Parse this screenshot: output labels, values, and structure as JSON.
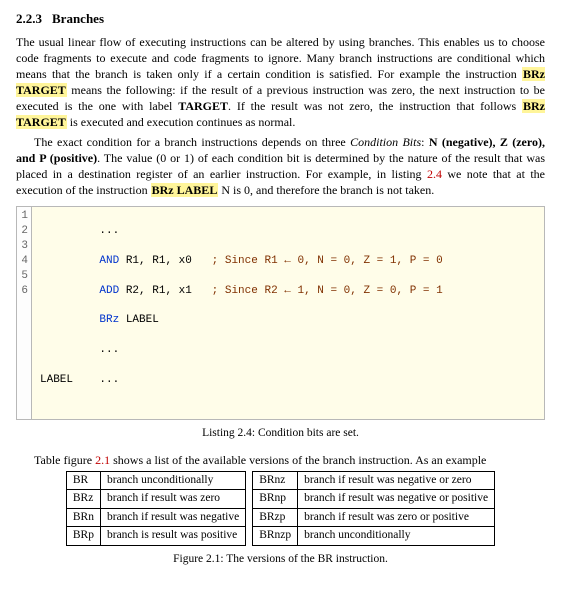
{
  "heading": {
    "number": "2.2.3",
    "title": "Branches"
  },
  "para1_a": "The usual linear flow of executing instructions can be altered by using branches. This enables us to choose code fragments to execute and code fragments to ignore. Many branch instructions are conditional which means that the branch is taken only if a certain condition is satisfied. For example the instruction ",
  "para1_hl1": "BRz TARGET",
  "para1_b": " means the following: if the result of a previous instruction was zero, the next instruction to be executed is the one with label ",
  "para1_bold1": "TARGET",
  "para1_c": ". If the result was not zero, the instruction that follows ",
  "para1_hl2": "BRz TARGET",
  "para1_d": " is executed and execution continues as normal.",
  "para2_a": "The exact condition for a branch instructions depends on three ",
  "para2_em": "Condition Bits",
  "para2_b": ": ",
  "para2_bold": "N (negative), Z (zero), and P (positive)",
  "para2_c": ". The value (0 or 1) of each condition bit is determined by the nature of the result that was placed in a destination register of an earlier instruction. For example, in listing ",
  "para2_ref": "2.4",
  "para2_d": " we note that at the execution of the instruction ",
  "para2_hl": "BRz LABEL",
  "para2_e": " N is 0, and therefore the branch is not taken.",
  "listing": {
    "gutter": [
      "1",
      "2",
      "3",
      "4",
      "5",
      "6"
    ],
    "lines": {
      "l1": "         ...",
      "l2a": "         ",
      "l2kw": "AND",
      "l2b": " R1, R1, x0   ",
      "l2c": "; Since R1 ← 0, N = 0, Z = 1, P = 0",
      "l3a": "         ",
      "l3kw": "ADD",
      "l3b": " R2, R1, x1   ",
      "l3c": "; Since R2 ← 1, N = 0, Z = 0, P = 1",
      "l4a": "         ",
      "l4kw": "BRz",
      "l4b": " LABEL",
      "l5": "         ...",
      "l6a": "LABEL    ",
      "l6b": "..."
    }
  },
  "listing_caption": "Listing 2.4: Condition bits are set.",
  "table_intro_a": "Table figure ",
  "table_intro_ref": "2.1",
  "table_intro_b": " shows a list of the available versions of the branch instruction. As an example",
  "br_table_left": [
    {
      "m": "BR",
      "d": "branch unconditionally"
    },
    {
      "m": "BRz",
      "d": "branch if result was zero"
    },
    {
      "m": "BRn",
      "d": "branch if result was negative"
    },
    {
      "m": "BRp",
      "d": "branch is result was positive"
    }
  ],
  "br_table_right": [
    {
      "m": "BRnz",
      "d": "branch if result was negative or zero"
    },
    {
      "m": "BRnp",
      "d": "branch if result was negative or positive"
    },
    {
      "m": "BRzp",
      "d": "branch if result was zero or positive"
    },
    {
      "m": "BRnzp",
      "d": "branch unconditionally"
    }
  ],
  "figure_caption": "Figure 2.1: The versions of the BR instruction."
}
